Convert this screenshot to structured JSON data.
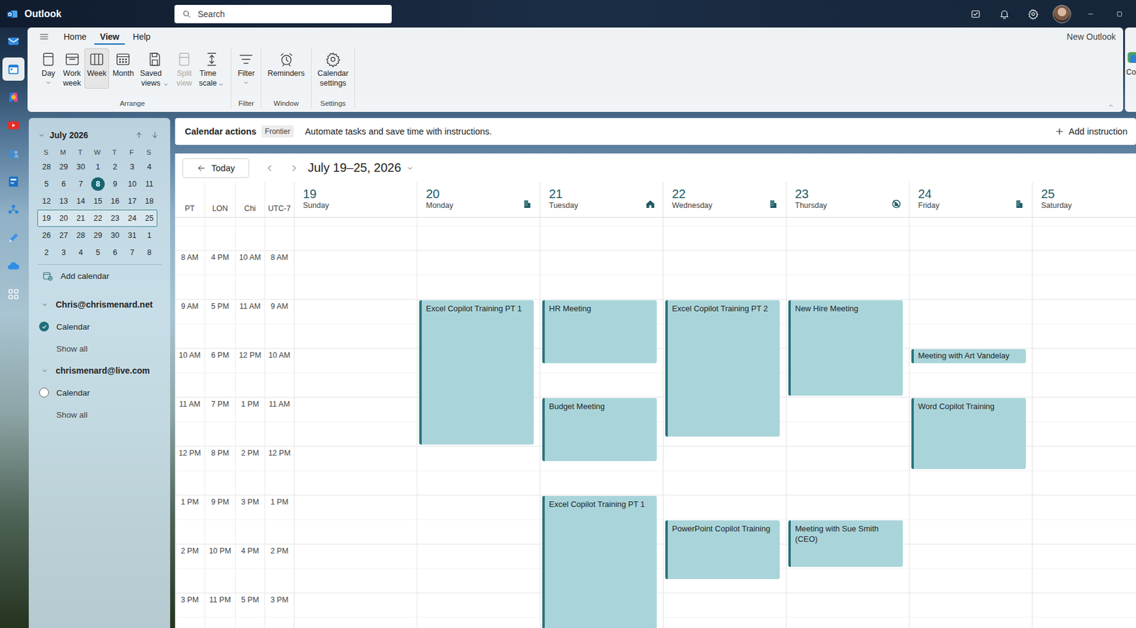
{
  "app": {
    "title": "Outlook"
  },
  "search": {
    "placeholder": "Search"
  },
  "rail": [
    {
      "selected": false
    },
    {
      "selected": true
    },
    {
      "selected": false
    },
    {
      "selected": false
    },
    {
      "selected": false
    },
    {
      "selected": false
    },
    {
      "selected": false
    },
    {
      "selected": false
    },
    {
      "selected": false
    },
    {
      "selected": false
    }
  ],
  "ribbon": {
    "tabs": [
      {
        "label": "Home",
        "selected": false
      },
      {
        "label": "View",
        "selected": true
      },
      {
        "label": "Help",
        "selected": false
      }
    ],
    "mode_label": "New Outlook",
    "groups": [
      {
        "label": "Arrange",
        "buttons": [
          {
            "label": "Day",
            "selected": false,
            "disabled": false,
            "dropdown": true
          },
          {
            "label": "Work week",
            "selected": false,
            "disabled": false,
            "dropdown": false
          },
          {
            "label": "Week",
            "selected": true,
            "disabled": false,
            "dropdown": false
          },
          {
            "label": "Month",
            "selected": false,
            "disabled": false,
            "dropdown": false
          },
          {
            "label": "Saved views",
            "selected": false,
            "disabled": false,
            "dropdown": true
          },
          {
            "label": "Split view",
            "selected": false,
            "disabled": true,
            "dropdown": false
          },
          {
            "label": "Time scale",
            "selected": false,
            "disabled": false,
            "dropdown": true
          }
        ]
      },
      {
        "label": "Filter",
        "buttons": [
          {
            "label": "Filter",
            "selected": false,
            "disabled": false,
            "dropdown": true
          }
        ]
      },
      {
        "label": "Window",
        "buttons": [
          {
            "label": "Reminders",
            "selected": false,
            "disabled": false,
            "dropdown": false
          }
        ]
      },
      {
        "label": "Settings",
        "buttons": [
          {
            "label": "Calendar settings",
            "selected": false,
            "disabled": false,
            "dropdown": false
          }
        ]
      }
    ],
    "overflow_label": "Co"
  },
  "mini_calendar": {
    "title": "July 2026",
    "weekdays": [
      "S",
      "M",
      "T",
      "W",
      "T",
      "F",
      "S"
    ],
    "weeks": [
      {
        "selected": false,
        "days": [
          {
            "label": "28",
            "today": false
          },
          {
            "label": "29",
            "today": false
          },
          {
            "label": "30",
            "today": false
          },
          {
            "label": "1",
            "today": false
          },
          {
            "label": "2",
            "today": false
          },
          {
            "label": "3",
            "today": false
          },
          {
            "label": "4",
            "today": false
          }
        ]
      },
      {
        "selected": false,
        "days": [
          {
            "label": "5",
            "today": false
          },
          {
            "label": "6",
            "today": false
          },
          {
            "label": "7",
            "today": false
          },
          {
            "label": "8",
            "today": true
          },
          {
            "label": "9",
            "today": false
          },
          {
            "label": "10",
            "today": false
          },
          {
            "label": "11",
            "today": false
          }
        ]
      },
      {
        "selected": false,
        "days": [
          {
            "label": "12",
            "today": false
          },
          {
            "label": "13",
            "today": false
          },
          {
            "label": "14",
            "today": false
          },
          {
            "label": "15",
            "today": false
          },
          {
            "label": "16",
            "today": false
          },
          {
            "label": "17",
            "today": false
          },
          {
            "label": "18",
            "today": false
          }
        ]
      },
      {
        "selected": true,
        "days": [
          {
            "label": "19",
            "today": false
          },
          {
            "label": "20",
            "today": false
          },
          {
            "label": "21",
            "today": false
          },
          {
            "label": "22",
            "today": false
          },
          {
            "label": "23",
            "today": false
          },
          {
            "label": "24",
            "today": false
          },
          {
            "label": "25",
            "today": false
          }
        ]
      },
      {
        "selected": false,
        "days": [
          {
            "label": "26",
            "today": false
          },
          {
            "label": "27",
            "today": false
          },
          {
            "label": "28",
            "today": false
          },
          {
            "label": "29",
            "today": false
          },
          {
            "label": "30",
            "today": false
          },
          {
            "label": "31",
            "today": false
          },
          {
            "label": "1",
            "today": false
          }
        ]
      },
      {
        "selected": false,
        "days": [
          {
            "label": "2",
            "today": false
          },
          {
            "label": "3",
            "today": false
          },
          {
            "label": "4",
            "today": false
          },
          {
            "label": "5",
            "today": false
          },
          {
            "label": "6",
            "today": false
          },
          {
            "label": "7",
            "today": false
          },
          {
            "label": "8",
            "today": false
          }
        ]
      }
    ]
  },
  "add_calendar": "Add calendar",
  "accounts": [
    {
      "name": "Chris@chrismenard.net",
      "expanded": true,
      "calendars": [
        {
          "label": "Calendar",
          "checked": true
        }
      ],
      "show_all": "Show all"
    },
    {
      "name": "chrismenard@live.com",
      "expanded": true,
      "calendars": [
        {
          "label": "Calendar",
          "checked": false
        }
      ],
      "show_all": "Show all"
    }
  ],
  "actions_bar": {
    "title": "Calendar actions",
    "badge": "Frontier",
    "description": "Automate tasks and save time with instructions.",
    "add": "Add instruction"
  },
  "nav": {
    "today": "Today",
    "range": "July 19–25, 2026"
  },
  "time_zones": {
    "labels": [
      "PT",
      "LON",
      "Chi",
      "UTC-7"
    ],
    "hours": [
      {
        "hour": 8,
        "labels": [
          "8 AM",
          "4 PM",
          "10 AM",
          "8 AM"
        ]
      },
      {
        "hour": 9,
        "labels": [
          "9 AM",
          "5 PM",
          "11 AM",
          "9 AM"
        ]
      },
      {
        "hour": 10,
        "labels": [
          "10 AM",
          "6 PM",
          "12 PM",
          "10 AM"
        ]
      },
      {
        "hour": 11,
        "labels": [
          "11 AM",
          "7 PM",
          "1 PM",
          "11 AM"
        ]
      },
      {
        "hour": 12,
        "labels": [
          "12 PM",
          "8 PM",
          "2 PM",
          "12 PM"
        ]
      },
      {
        "hour": 13,
        "labels": [
          "1 PM",
          "9 PM",
          "3 PM",
          "1 PM"
        ]
      },
      {
        "hour": 14,
        "labels": [
          "2 PM",
          "10 PM",
          "4 PM",
          "2 PM"
        ]
      },
      {
        "hour": 15,
        "labels": [
          "3 PM",
          "11 PM",
          "5 PM",
          "3 PM"
        ]
      }
    ]
  },
  "days": [
    {
      "number": "19",
      "name": "Sunday",
      "location": "none",
      "events": []
    },
    {
      "number": "20",
      "name": "Monday",
      "location": "office",
      "events": [
        {
          "title": "Excel Copilot Training PT 1",
          "start": 9,
          "end": 12
        }
      ]
    },
    {
      "number": "21",
      "name": "Tuesday",
      "location": "home",
      "events": [
        {
          "title": "HR Meeting",
          "start": 9,
          "end": 10.33
        },
        {
          "title": "Budget Meeting",
          "start": 11,
          "end": 12.33
        },
        {
          "title": "Excel Copilot Training PT 1",
          "start": 13,
          "end": 16.5
        }
      ]
    },
    {
      "number": "22",
      "name": "Wednesday",
      "location": "office",
      "events": [
        {
          "title": "Excel Copilot Training PT 2",
          "start": 9,
          "end": 11.83
        },
        {
          "title": "PowerPoint Copilot Training",
          "start": 13.5,
          "end": 14.75
        }
      ]
    },
    {
      "number": "23",
      "name": "Thursday",
      "location": "off",
      "events": [
        {
          "title": "New Hire Meeting",
          "start": 9,
          "end": 11
        },
        {
          "title": "Meeting with Sue Smith (CEO)",
          "start": 13.5,
          "end": 14.5
        }
      ]
    },
    {
      "number": "24",
      "name": "Friday",
      "location": "office",
      "events": [
        {
          "title": "Meeting with Art Vandelay",
          "start": 10,
          "end": 10.33
        },
        {
          "title": "Word Copilot Training",
          "start": 11,
          "end": 12.5
        }
      ]
    },
    {
      "number": "25",
      "name": "Saturday",
      "location": "none",
      "events": []
    }
  ]
}
